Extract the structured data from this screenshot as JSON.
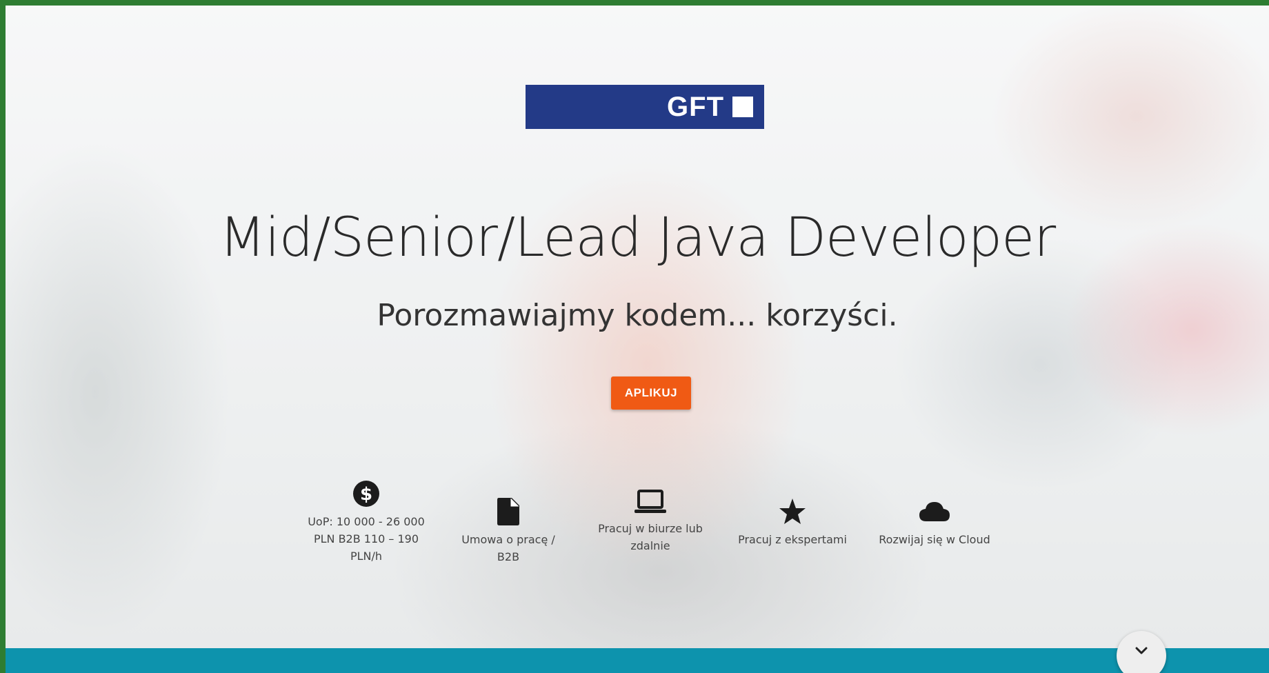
{
  "logo": {
    "text": "GFT",
    "brand_color": "#233a87"
  },
  "hero": {
    "title": "Mid/Senior/Lead Java Developer",
    "subtitle": "Porozmawiajmy kodem... korzyści.",
    "apply_label": "APLIKUJ",
    "apply_color": "#f05a14"
  },
  "features": [
    {
      "icon": "dollar-icon",
      "label": "UoP: 10 000 - 26 000 PLN B2B 110 – 190 PLN/h"
    },
    {
      "icon": "document-icon",
      "label": "Umowa o pracę / B2B"
    },
    {
      "icon": "laptop-icon",
      "label": "Pracuj w biurze lub zdalnie"
    },
    {
      "icon": "star-icon",
      "label": "Pracuj z ekspertami"
    },
    {
      "icon": "cloud-icon",
      "label": "Rozwijaj się w Cloud"
    }
  ],
  "scroll_button": {
    "icon": "chevron-down-icon"
  },
  "colors": {
    "frame_border": "#2e7d32",
    "bottom_bar": "#0d93ad"
  }
}
